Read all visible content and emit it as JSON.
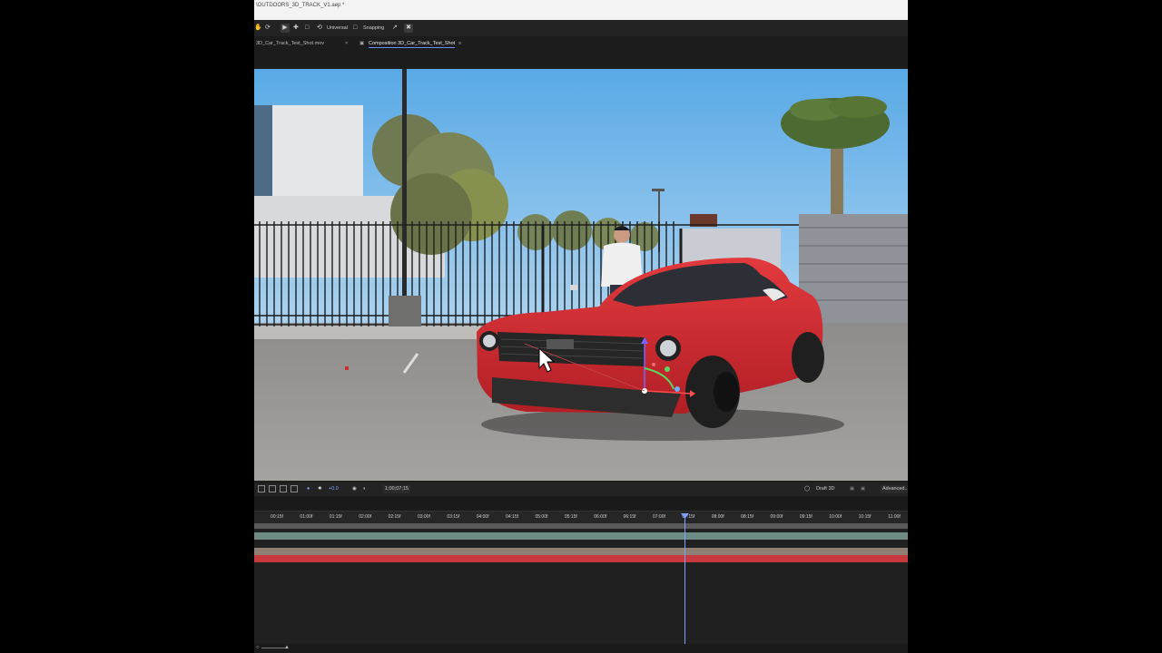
{
  "window": {
    "title": "\\OUTDOORS_3D_TRACK_V1.aep *"
  },
  "toolbar": {
    "universal_label": "Universal",
    "snapping_label": "Snapping",
    "icons": [
      "hand-tool-icon",
      "rotate-icon",
      "selection-tool-icon",
      "anchor-tool-icon",
      "pan-behind-icon",
      "universal-icon",
      "snapping-checkbox-icon",
      "expand-icon",
      "snapping-options-icon"
    ]
  },
  "tabs": {
    "footage": "3D_Car_Track_Test_Shot.mov",
    "composition": "Composition 3D_Car_Track_Test_Shot"
  },
  "viewer_bar": {
    "exposure": "+0.0",
    "timecode": "1;00;07;15",
    "renderer": "Draft 3D",
    "advanced": "Advanced..."
  },
  "timeline": {
    "ruler_ticks": [
      "00:15f",
      "01:00f",
      "01:15f",
      "02:00f",
      "02:15f",
      "03:00f",
      "03:15f",
      "04:00f",
      "04:15f",
      "05:00f",
      "05:15f",
      "06:00f",
      "06:15f",
      "07:00f",
      "07:15f",
      "08:00f",
      "08:15f",
      "09:00f",
      "09:15f",
      "10:00f",
      "10:15f",
      "11:00f"
    ],
    "current_frame_fraction": 0.66
  },
  "colors": {
    "accent_blue": "#7aa4ff",
    "track_gray": "#6e8a84",
    "track_tan": "#8f7f72",
    "track_red": "#c63a3f",
    "car_red": "#c9272c"
  }
}
